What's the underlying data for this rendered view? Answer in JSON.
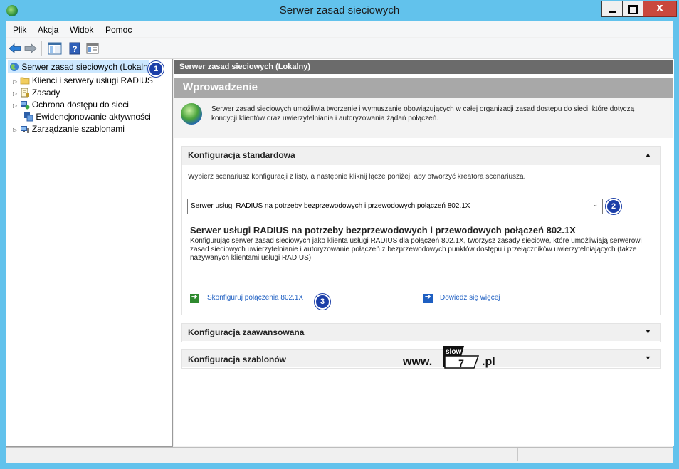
{
  "window": {
    "title": "Serwer zasad sieciowych",
    "close_glyph": "x"
  },
  "menubar": [
    "Plik",
    "Akcja",
    "Widok",
    "Pomoc"
  ],
  "toolbar": {
    "icons": [
      "back-arrow-icon",
      "forward-arrow-icon",
      "show-tree-icon",
      "help-icon",
      "properties-icon"
    ]
  },
  "tree": {
    "items": [
      {
        "label": "Serwer zasad sieciowych (Lokalny)",
        "icon": "nps-globe-icon",
        "selected": true
      },
      {
        "label": "Klienci i serwery usługi RADIUS",
        "icon": "folder-icon"
      },
      {
        "label": "Zasady",
        "icon": "policy-icon"
      },
      {
        "label": "Ochrona dostępu do sieci",
        "icon": "nap-icon"
      },
      {
        "label": "Ewidencjonowanie aktywności",
        "icon": "accounting-icon"
      },
      {
        "label": "Zarządzanie szablonami",
        "icon": "templates-icon"
      }
    ],
    "badge": "1"
  },
  "main": {
    "header": "Serwer zasad sieciowych (Lokalny)",
    "intro_title": "Wprowadzenie",
    "intro_text": "Serwer zasad sieciowych umożliwia tworzenie i wymuszanie obowiązujących w całej organizacji zasad dostępu do sieci, które dotyczą kondycji klientów oraz uwierzytelniania i autoryzowania żądań połączeń.",
    "standard": {
      "title": "Konfiguracja standardowa",
      "description": "Wybierz scenariusz konfiguracji z listy, a następnie kliknij łącze poniżej, aby otworzyć kreatora scenariusza.",
      "select_value": "Serwer usługi RADIUS na potrzeby bezprzewodowych i przewodowych połączeń 802.1X",
      "select_badge": "2",
      "scenario_title": "Serwer usługi RADIUS na potrzeby bezprzewodowych i przewodowych połączeń 802.1X",
      "scenario_desc": "Konfigurując serwer zasad sieciowych jako klienta usługi RADIUS dla połączeń 802.1X, tworzysz zasady sieciowe, które umożliwiają serwerowi zasad sieciowych uwierzytelnianie i autoryzowanie połączeń z bezprzewodowych punktów dostępu i przełączników uwierzytelniających (także nazywanych klientami usługi RADIUS).",
      "link_configure": "Skonfiguruj połączenia 802.1X",
      "link_badge": "3",
      "link_learn": "Dowiedz się więcej"
    },
    "advanced_title": "Konfiguracja zaawansowana",
    "templates_title": "Konfiguracja szablonów"
  },
  "watermark": {
    "prefix": "www.",
    "box_top": "slow",
    "box_num": "7",
    "suffix": ".pl"
  },
  "colors": {
    "frame": "#62c2ec",
    "header_bg": "#6b6b6b",
    "intro_bg": "#a8a8a8",
    "link": "#1e5fc2",
    "badge": "#1c3fa8"
  }
}
